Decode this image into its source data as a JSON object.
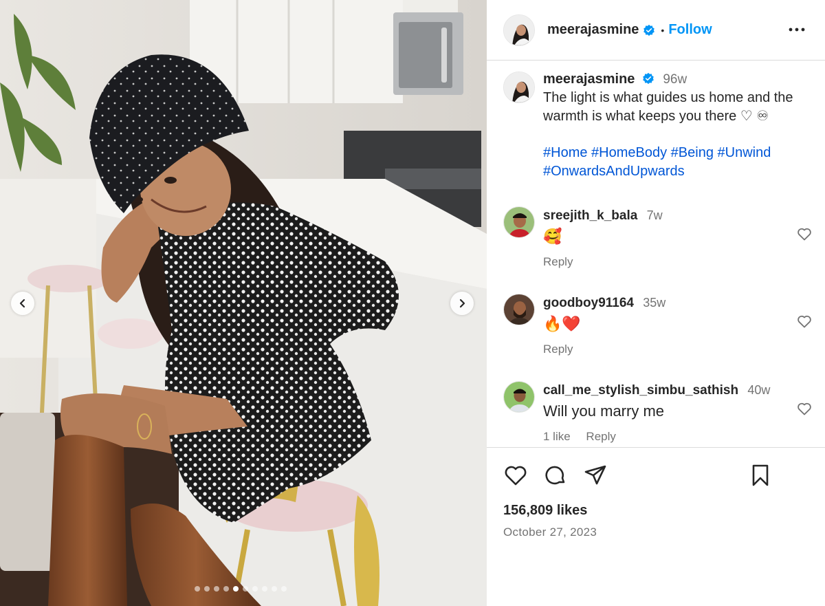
{
  "media": {
    "alt_note": "",
    "slide_count": 10,
    "active_slide": 5
  },
  "post": {
    "username": "meerajasmine",
    "follow_label": "Follow",
    "separator": "•",
    "caption_age": "96w",
    "caption_text": "The light is what guides us home and the warmth is what keeps you there ♡ ♾",
    "hashtags": [
      "#Home",
      "#HomeBody",
      "#Being",
      "#Unwind",
      "#OnwardsAndUpwards"
    ],
    "likes": "156,809 likes",
    "date": "October 27, 2023"
  },
  "comments": [
    {
      "username": "sreejith_k_bala",
      "age": "7w",
      "text": "🥰",
      "reply": "Reply",
      "likes": ""
    },
    {
      "username": "goodboy91164",
      "age": "35w",
      "text": "🔥❤️",
      "reply": "Reply",
      "likes": ""
    },
    {
      "username": "call_me_stylish_simbu_sathish",
      "age": "40w",
      "text": "Will you marry me",
      "reply": "Reply",
      "likes": "1 like"
    }
  ],
  "icons": {
    "verified": "verified-badge-icon",
    "more": "more-options-icon",
    "like": "heart-icon",
    "comment": "comment-icon",
    "share": "share-icon",
    "save": "bookmark-icon",
    "prev": "chevron-left-icon",
    "next": "chevron-right-icon"
  },
  "colors": {
    "accent": "#0095f6",
    "hashtag": "#0056d6",
    "muted": "#737373",
    "verified": "#0095f6"
  }
}
